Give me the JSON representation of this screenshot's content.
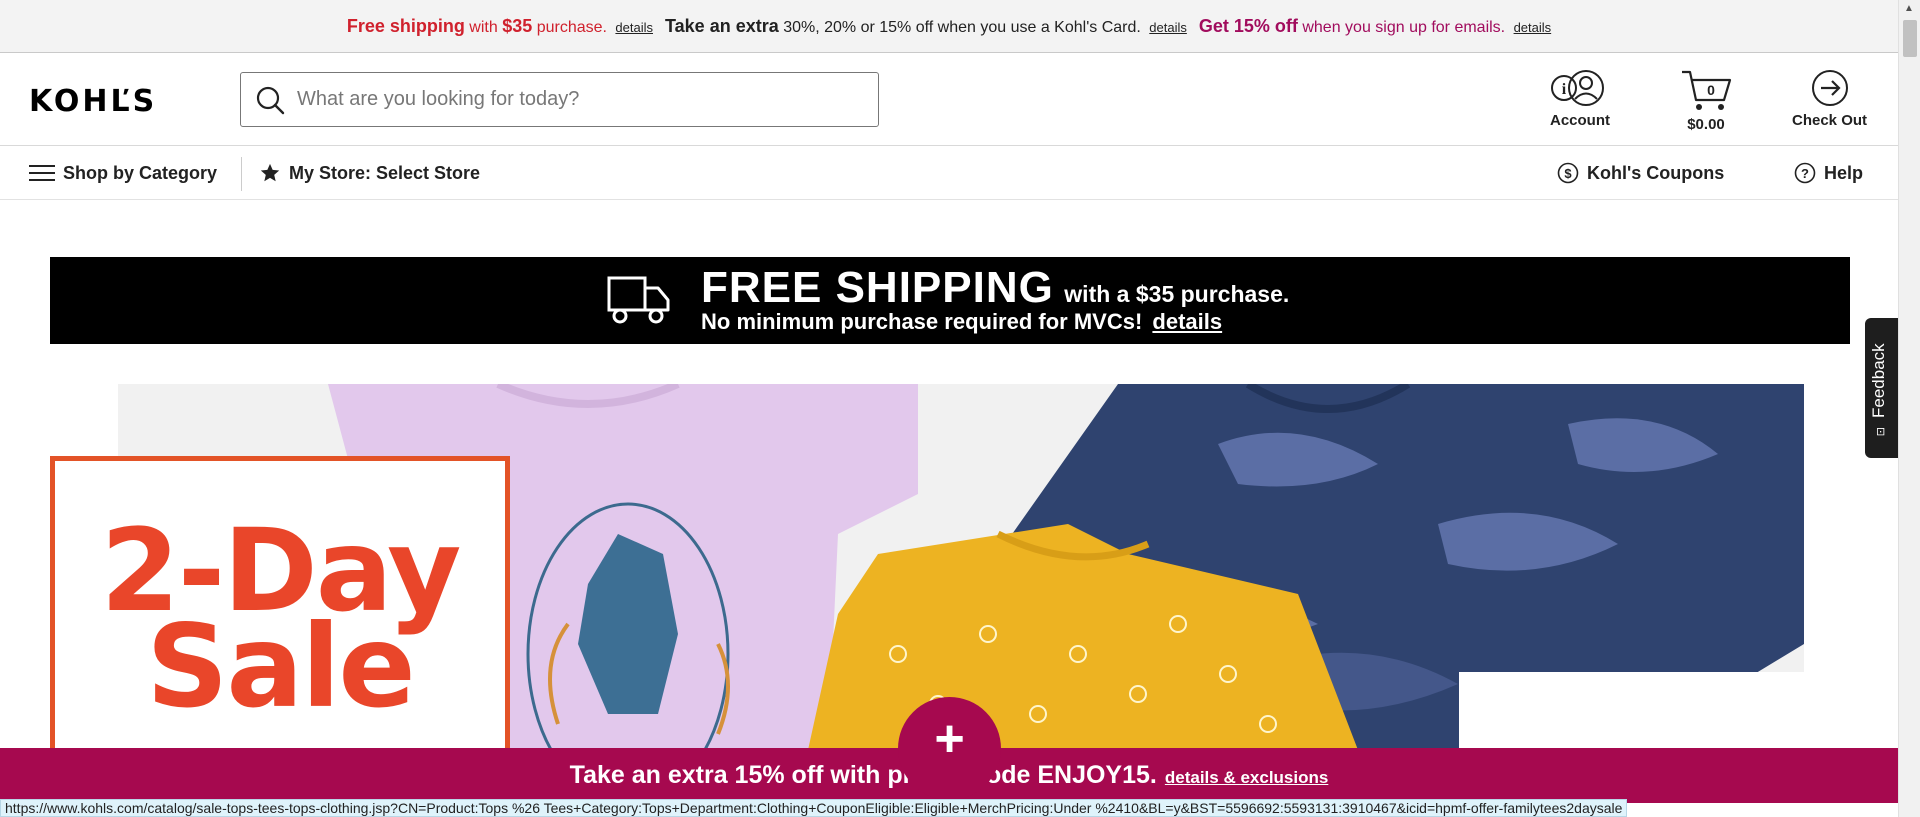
{
  "promo_strip": {
    "free_shipping": "Free shipping",
    "with": "with",
    "amount": "$35",
    "purchase": "purchase.",
    "details_1": "details",
    "take_extra": "Take an extra",
    "card_offer": "30%, 20% or 15% off when you use a Kohl's Card.",
    "details_2": "details",
    "get_off": "Get 15% off",
    "email_offer": "when you sign up for emails.",
    "details_3": "details"
  },
  "header": {
    "logo": "KOHĽS",
    "search_placeholder": "What are you looking for today?",
    "account_label": "Account",
    "cart_count": "0",
    "cart_total": "$0.00",
    "checkout_label": "Check Out"
  },
  "nav": {
    "shop_by_category": "Shop by Category",
    "my_store": "My Store: Select Store",
    "coupons": "Kohl's Coupons",
    "help": "Help"
  },
  "shipping_banner": {
    "headline": "FREE SHIPPING",
    "subhead": "with a $35 purchase.",
    "line2": "No minimum purchase required for MVCs!",
    "details": "details"
  },
  "hero": {
    "sale_line1": "2-Day",
    "sale_line2": "Sale"
  },
  "promo_footer": {
    "text": "Take an extra 15% off with promo code ENJOY15.",
    "link": "details & exclusions"
  },
  "status_bar": {
    "url": "https://www.kohls.com/catalog/sale-tops-tees-tops-clothing.jsp?CN=Product:Tops %26 Tees+Category:Tops+Department:Clothing+CouponEligible:Eligible+MerchPricing:Under %2410&BL=y&BST=5596692:5593131:3910467&icid=hpmf-offer-familytees2daysale"
  },
  "feedback": {
    "label": "Feedback"
  },
  "colors": {
    "brand_red": "#d0212d",
    "brand_magenta": "#a10c5d",
    "promo_bg": "#a6094f",
    "sale_orange": "#e9462a"
  }
}
